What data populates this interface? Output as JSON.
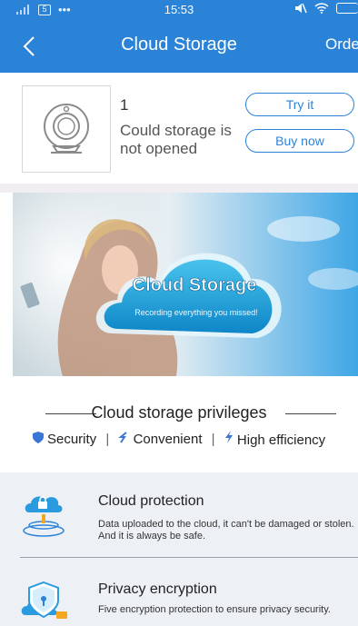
{
  "status_bar": {
    "time": "15:53",
    "carrier_badge": "5"
  },
  "nav": {
    "title": "Cloud Storage",
    "order_label": "Order"
  },
  "device": {
    "id": "1",
    "status": "Could storage is not opened",
    "try_label": "Try it",
    "buy_label": "Buy now"
  },
  "banner": {
    "title": "Cloud Storage",
    "subtitle": "Recording everything you missed!"
  },
  "privileges": {
    "title": "Cloud storage privileges",
    "items": [
      "Security",
      "Convenient",
      "High efficiency"
    ]
  },
  "features": [
    {
      "title": "Cloud protection",
      "desc": "Data uploaded to the cloud, it can't be damaged or stolen. And it is always be safe."
    },
    {
      "title": "Privacy encryption",
      "desc": "Five encryption protection to ensure privacy security."
    }
  ],
  "colors": {
    "accent": "#2b83d8",
    "band": "#edf1f5"
  }
}
